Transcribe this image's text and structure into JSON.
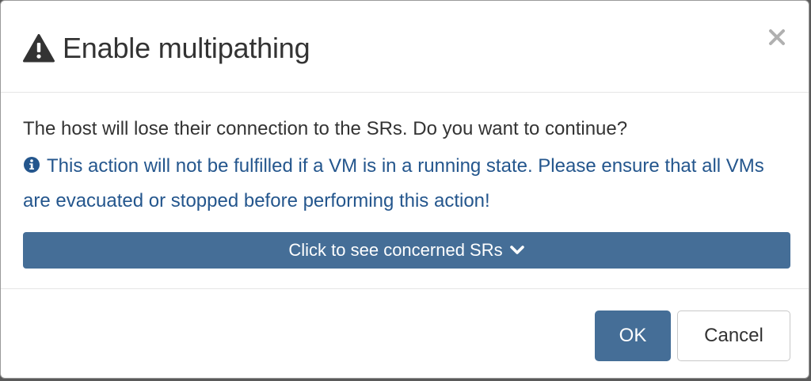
{
  "dialog": {
    "title": "Enable multipathing",
    "close_symbol": "×",
    "title_icon": "warning-triangle-icon",
    "close_icon": "close-icon"
  },
  "body": {
    "question": "The host will lose their connection to the SRs. Do you want to continue?",
    "warning": "This action will not be fulfilled if a VM is in a running state. Please ensure that all VMs are evacuated or stopped before performing this action!",
    "warning_icon": "info-circle-icon",
    "toggle_label": "Click to see concerned SRs",
    "toggle_icon": "chevron-down-icon"
  },
  "footer": {
    "ok_label": "OK",
    "cancel_label": "Cancel"
  },
  "colors": {
    "primary": "#456e97",
    "info_text": "#24568d",
    "text": "#333333"
  }
}
